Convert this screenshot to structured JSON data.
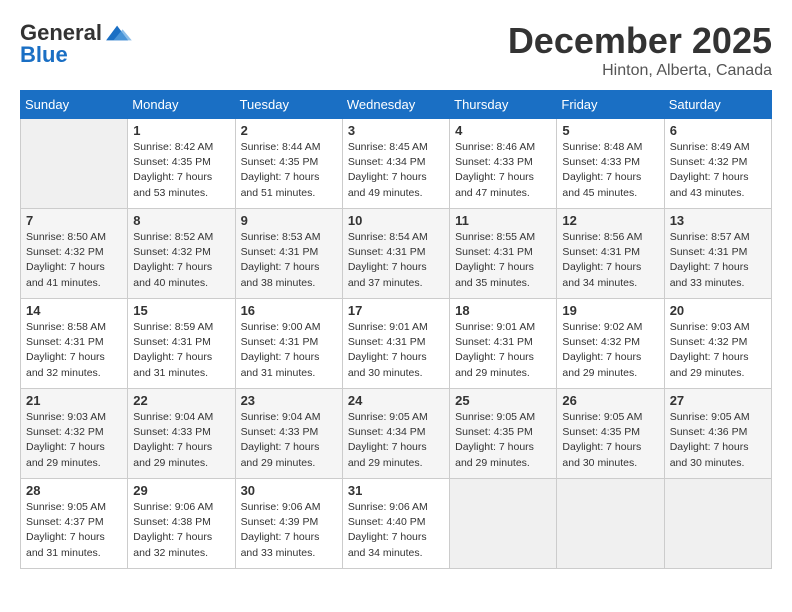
{
  "logo": {
    "general": "General",
    "blue": "Blue"
  },
  "title": "December 2025",
  "location": "Hinton, Alberta, Canada",
  "days_of_week": [
    "Sunday",
    "Monday",
    "Tuesday",
    "Wednesday",
    "Thursday",
    "Friday",
    "Saturday"
  ],
  "weeks": [
    [
      {
        "day": "",
        "sunrise": "",
        "sunset": "",
        "daylight": ""
      },
      {
        "day": "1",
        "sunrise": "Sunrise: 8:42 AM",
        "sunset": "Sunset: 4:35 PM",
        "daylight": "Daylight: 7 hours and 53 minutes."
      },
      {
        "day": "2",
        "sunrise": "Sunrise: 8:44 AM",
        "sunset": "Sunset: 4:35 PM",
        "daylight": "Daylight: 7 hours and 51 minutes."
      },
      {
        "day": "3",
        "sunrise": "Sunrise: 8:45 AM",
        "sunset": "Sunset: 4:34 PM",
        "daylight": "Daylight: 7 hours and 49 minutes."
      },
      {
        "day": "4",
        "sunrise": "Sunrise: 8:46 AM",
        "sunset": "Sunset: 4:33 PM",
        "daylight": "Daylight: 7 hours and 47 minutes."
      },
      {
        "day": "5",
        "sunrise": "Sunrise: 8:48 AM",
        "sunset": "Sunset: 4:33 PM",
        "daylight": "Daylight: 7 hours and 45 minutes."
      },
      {
        "day": "6",
        "sunrise": "Sunrise: 8:49 AM",
        "sunset": "Sunset: 4:32 PM",
        "daylight": "Daylight: 7 hours and 43 minutes."
      }
    ],
    [
      {
        "day": "7",
        "sunrise": "Sunrise: 8:50 AM",
        "sunset": "Sunset: 4:32 PM",
        "daylight": "Daylight: 7 hours and 41 minutes."
      },
      {
        "day": "8",
        "sunrise": "Sunrise: 8:52 AM",
        "sunset": "Sunset: 4:32 PM",
        "daylight": "Daylight: 7 hours and 40 minutes."
      },
      {
        "day": "9",
        "sunrise": "Sunrise: 8:53 AM",
        "sunset": "Sunset: 4:31 PM",
        "daylight": "Daylight: 7 hours and 38 minutes."
      },
      {
        "day": "10",
        "sunrise": "Sunrise: 8:54 AM",
        "sunset": "Sunset: 4:31 PM",
        "daylight": "Daylight: 7 hours and 37 minutes."
      },
      {
        "day": "11",
        "sunrise": "Sunrise: 8:55 AM",
        "sunset": "Sunset: 4:31 PM",
        "daylight": "Daylight: 7 hours and 35 minutes."
      },
      {
        "day": "12",
        "sunrise": "Sunrise: 8:56 AM",
        "sunset": "Sunset: 4:31 PM",
        "daylight": "Daylight: 7 hours and 34 minutes."
      },
      {
        "day": "13",
        "sunrise": "Sunrise: 8:57 AM",
        "sunset": "Sunset: 4:31 PM",
        "daylight": "Daylight: 7 hours and 33 minutes."
      }
    ],
    [
      {
        "day": "14",
        "sunrise": "Sunrise: 8:58 AM",
        "sunset": "Sunset: 4:31 PM",
        "daylight": "Daylight: 7 hours and 32 minutes."
      },
      {
        "day": "15",
        "sunrise": "Sunrise: 8:59 AM",
        "sunset": "Sunset: 4:31 PM",
        "daylight": "Daylight: 7 hours and 31 minutes."
      },
      {
        "day": "16",
        "sunrise": "Sunrise: 9:00 AM",
        "sunset": "Sunset: 4:31 PM",
        "daylight": "Daylight: 7 hours and 31 minutes."
      },
      {
        "day": "17",
        "sunrise": "Sunrise: 9:01 AM",
        "sunset": "Sunset: 4:31 PM",
        "daylight": "Daylight: 7 hours and 30 minutes."
      },
      {
        "day": "18",
        "sunrise": "Sunrise: 9:01 AM",
        "sunset": "Sunset: 4:31 PM",
        "daylight": "Daylight: 7 hours and 29 minutes."
      },
      {
        "day": "19",
        "sunrise": "Sunrise: 9:02 AM",
        "sunset": "Sunset: 4:32 PM",
        "daylight": "Daylight: 7 hours and 29 minutes."
      },
      {
        "day": "20",
        "sunrise": "Sunrise: 9:03 AM",
        "sunset": "Sunset: 4:32 PM",
        "daylight": "Daylight: 7 hours and 29 minutes."
      }
    ],
    [
      {
        "day": "21",
        "sunrise": "Sunrise: 9:03 AM",
        "sunset": "Sunset: 4:32 PM",
        "daylight": "Daylight: 7 hours and 29 minutes."
      },
      {
        "day": "22",
        "sunrise": "Sunrise: 9:04 AM",
        "sunset": "Sunset: 4:33 PM",
        "daylight": "Daylight: 7 hours and 29 minutes."
      },
      {
        "day": "23",
        "sunrise": "Sunrise: 9:04 AM",
        "sunset": "Sunset: 4:33 PM",
        "daylight": "Daylight: 7 hours and 29 minutes."
      },
      {
        "day": "24",
        "sunrise": "Sunrise: 9:05 AM",
        "sunset": "Sunset: 4:34 PM",
        "daylight": "Daylight: 7 hours and 29 minutes."
      },
      {
        "day": "25",
        "sunrise": "Sunrise: 9:05 AM",
        "sunset": "Sunset: 4:35 PM",
        "daylight": "Daylight: 7 hours and 29 minutes."
      },
      {
        "day": "26",
        "sunrise": "Sunrise: 9:05 AM",
        "sunset": "Sunset: 4:35 PM",
        "daylight": "Daylight: 7 hours and 30 minutes."
      },
      {
        "day": "27",
        "sunrise": "Sunrise: 9:05 AM",
        "sunset": "Sunset: 4:36 PM",
        "daylight": "Daylight: 7 hours and 30 minutes."
      }
    ],
    [
      {
        "day": "28",
        "sunrise": "Sunrise: 9:05 AM",
        "sunset": "Sunset: 4:37 PM",
        "daylight": "Daylight: 7 hours and 31 minutes."
      },
      {
        "day": "29",
        "sunrise": "Sunrise: 9:06 AM",
        "sunset": "Sunset: 4:38 PM",
        "daylight": "Daylight: 7 hours and 32 minutes."
      },
      {
        "day": "30",
        "sunrise": "Sunrise: 9:06 AM",
        "sunset": "Sunset: 4:39 PM",
        "daylight": "Daylight: 7 hours and 33 minutes."
      },
      {
        "day": "31",
        "sunrise": "Sunrise: 9:06 AM",
        "sunset": "Sunset: 4:40 PM",
        "daylight": "Daylight: 7 hours and 34 minutes."
      },
      {
        "day": "",
        "sunrise": "",
        "sunset": "",
        "daylight": ""
      },
      {
        "day": "",
        "sunrise": "",
        "sunset": "",
        "daylight": ""
      },
      {
        "day": "",
        "sunrise": "",
        "sunset": "",
        "daylight": ""
      }
    ]
  ]
}
